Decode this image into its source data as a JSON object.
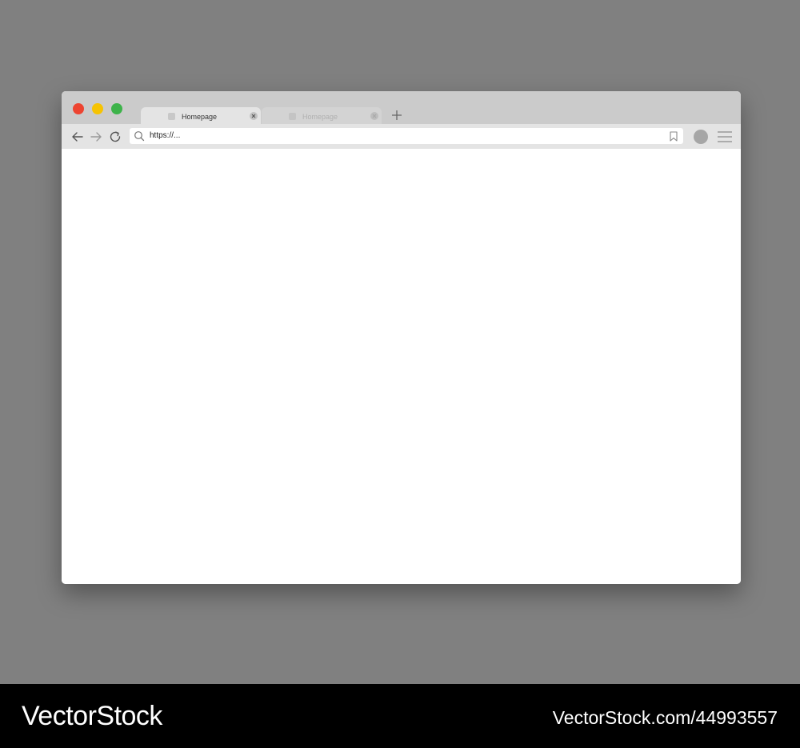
{
  "browser": {
    "tabs": [
      {
        "label": "Homepage",
        "active": true
      },
      {
        "label": "Homepage",
        "active": false
      }
    ],
    "address_bar": {
      "value": "https://..."
    },
    "colors": {
      "close": "#ed4431",
      "minimize": "#f6c302",
      "maximize": "#3db34a",
      "titlebar": "#cbcbcb",
      "toolbar": "#e4e4e4"
    },
    "icons": [
      "back-arrow-icon",
      "forward-arrow-icon",
      "reload-icon",
      "search-icon",
      "bookmark-icon",
      "menu-icon",
      "plus-icon",
      "close-icon"
    ]
  },
  "watermark": {
    "brand": "VectorStock",
    "reference": "VectorStock.com/44993557"
  }
}
